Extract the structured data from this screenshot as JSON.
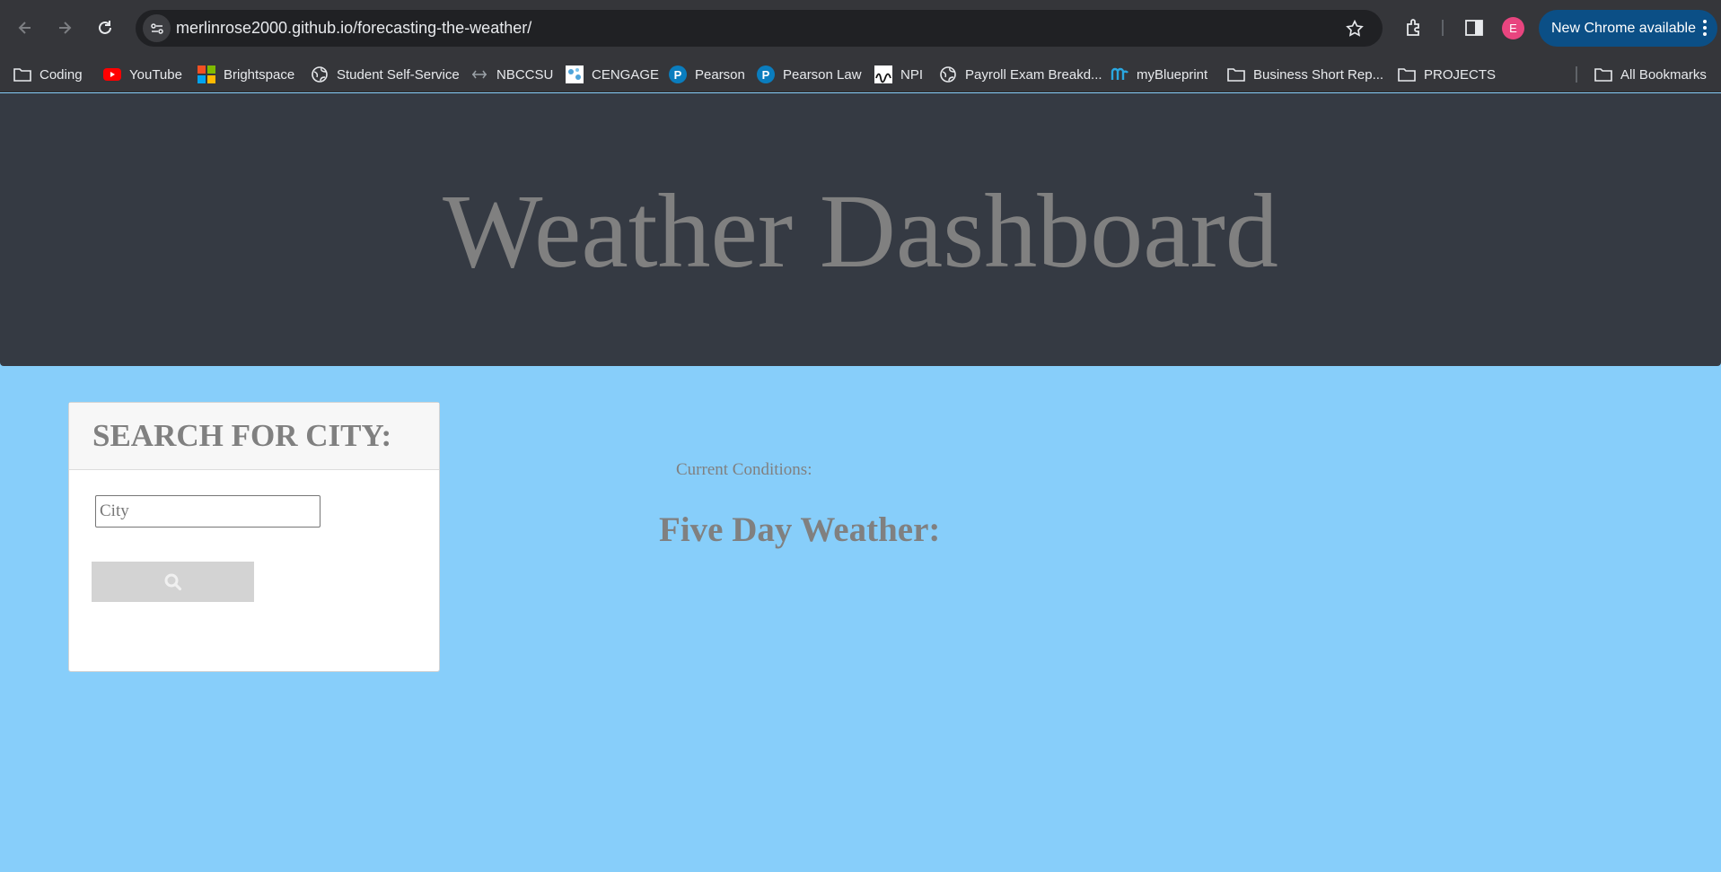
{
  "browser": {
    "url": "merlinrose2000.github.io/forecasting-the-weather/",
    "profile_initial": "E",
    "update_label": "New Chrome available",
    "colors": {
      "profile": "#e8457f",
      "update": "#0b4f86"
    }
  },
  "bookmarks": [
    {
      "label": "Coding",
      "icon": "folder-icon"
    },
    {
      "label": "YouTube",
      "icon": "youtube-icon"
    },
    {
      "label": "Brightspace",
      "icon": "microsoft-icon"
    },
    {
      "label": "Student Self-Service",
      "icon": "globe-icon"
    },
    {
      "label": "NBCCSU",
      "icon": "nbccsu-icon"
    },
    {
      "label": "CENGAGE",
      "icon": "cengage-icon"
    },
    {
      "label": "Pearson",
      "icon": "pearson-icon"
    },
    {
      "label": "Pearson Law",
      "icon": "pearson-icon"
    },
    {
      "label": "NPI",
      "icon": "npi-icon"
    },
    {
      "label": "Payroll Exam Breakd...",
      "icon": "globe-icon"
    },
    {
      "label": "myBlueprint",
      "icon": "myblueprint-icon"
    },
    {
      "label": "Business Short Rep...",
      "icon": "folder-icon"
    },
    {
      "label": "PROJECTS",
      "icon": "folder-icon"
    }
  ],
  "all_bookmarks_label": "All Bookmarks",
  "page": {
    "title": "Weather Dashboard",
    "search": {
      "heading": "SEARCH FOR CITY:",
      "placeholder": "City",
      "button_icon": "search-icon"
    },
    "current_conditions_label": "Current Conditions:",
    "five_day_heading": "Five Day Weather:",
    "colors": {
      "header_bg": "#353a43",
      "page_bg": "#87cefa",
      "text": "#808080"
    }
  }
}
